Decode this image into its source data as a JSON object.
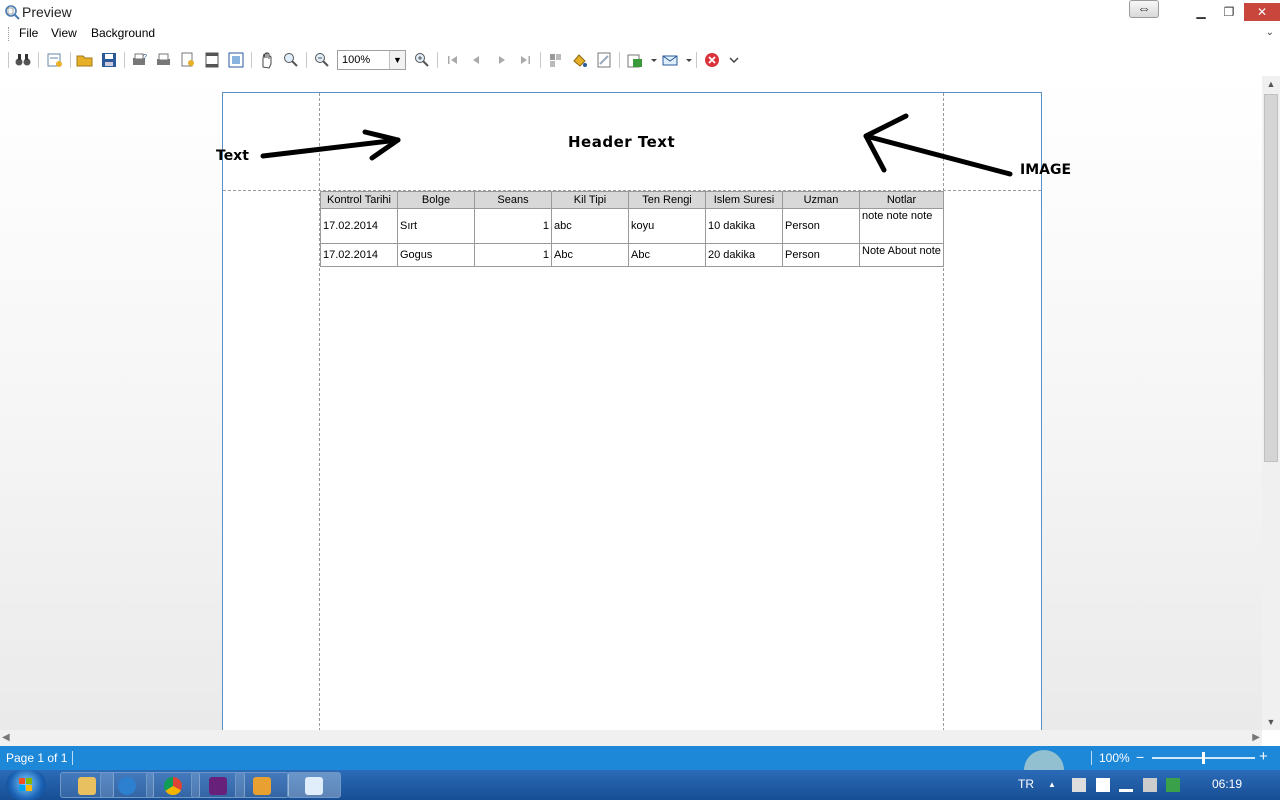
{
  "window": {
    "title": "Preview",
    "restore_glyph": "⇔",
    "min_glyph": "▁",
    "max_glyph": "❐",
    "close_glyph": "✕"
  },
  "menu": {
    "items": [
      {
        "label": "File"
      },
      {
        "label": "View"
      },
      {
        "label": "Background"
      }
    ],
    "chevron": "⌄"
  },
  "toolbar": {
    "zoom_value": "100%",
    "zoom_arrow": "▼"
  },
  "report": {
    "header_text": "Header Text",
    "columns": [
      "Kontrol Tarihi",
      "Bolge",
      "Seans",
      "Kil Tipi",
      "Ten Rengi",
      "Islem Suresi",
      "Uzman",
      "Notlar"
    ],
    "rows": [
      [
        "17.02.2014",
        "Sırt",
        "1",
        "abc",
        "koyu",
        "10 dakika",
        "Person",
        "note note note"
      ],
      [
        "17.02.2014",
        "Gogus",
        "1",
        "Abc",
        "Abc",
        "20 dakika",
        "Person",
        "Note About note"
      ]
    ]
  },
  "annotations": {
    "left_label": "Text",
    "right_label": "IMAGE"
  },
  "status": {
    "page_info": "Page 1 of 1",
    "zoom_percent": "100%",
    "zoom_minus": "−",
    "zoom_plus": "+",
    "zoom_level": 0.5
  },
  "taskbar": {
    "language": "TR",
    "clock": "06:19",
    "tray_up": "▲"
  },
  "scroll": {
    "up": "▲",
    "down": "▼",
    "left": "◀",
    "right": "▶"
  },
  "colors": {
    "accent": "#1e88d8",
    "close": "#c9463d",
    "page_border": "#5b8fc7",
    "table_header": "#d8d8d8"
  }
}
